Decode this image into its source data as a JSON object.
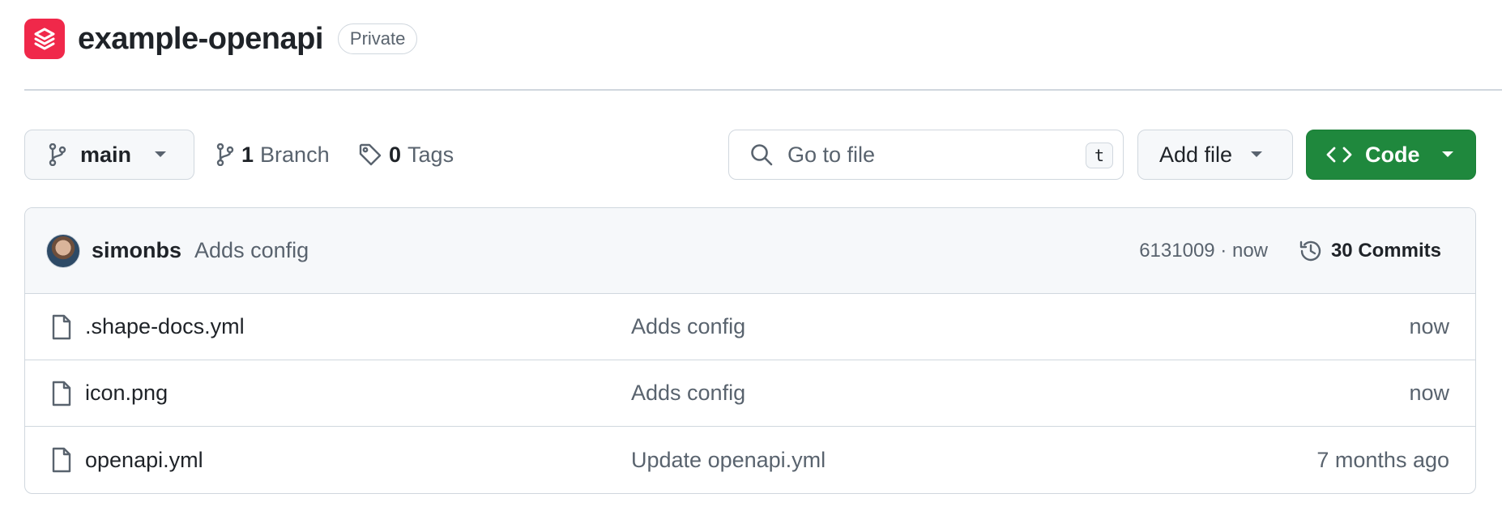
{
  "repo": {
    "name": "example-openapi",
    "visibility": "Private"
  },
  "toolbar": {
    "branch": "main",
    "branches_count": "1",
    "branches_label": "Branch",
    "tags_count": "0",
    "tags_label": "Tags",
    "search_placeholder": "Go to file",
    "search_shortcut": "t",
    "add_file_label": "Add file",
    "code_label": "Code"
  },
  "latest_commit": {
    "author": "simonbs",
    "message": "Adds config",
    "meta": "6131009 · now",
    "commits_label": "30 Commits"
  },
  "files": [
    {
      "name": ".shape-docs.yml",
      "commit": "Adds config",
      "time": "now"
    },
    {
      "name": "icon.png",
      "commit": "Adds config",
      "time": "now"
    },
    {
      "name": "openapi.yml",
      "commit": "Update openapi.yml",
      "time": "7 months ago"
    }
  ],
  "colors": {
    "logo": "#f0284a",
    "code_button": "#1f883d",
    "border": "#d0d7de",
    "muted_text": "#59636e"
  },
  "icons": {
    "logo": "layers-logo-icon",
    "branch": "git-branch-icon",
    "tag": "tag-icon",
    "search": "search-icon",
    "code": "code-brackets-icon",
    "history": "history-icon",
    "file": "file-icon"
  }
}
